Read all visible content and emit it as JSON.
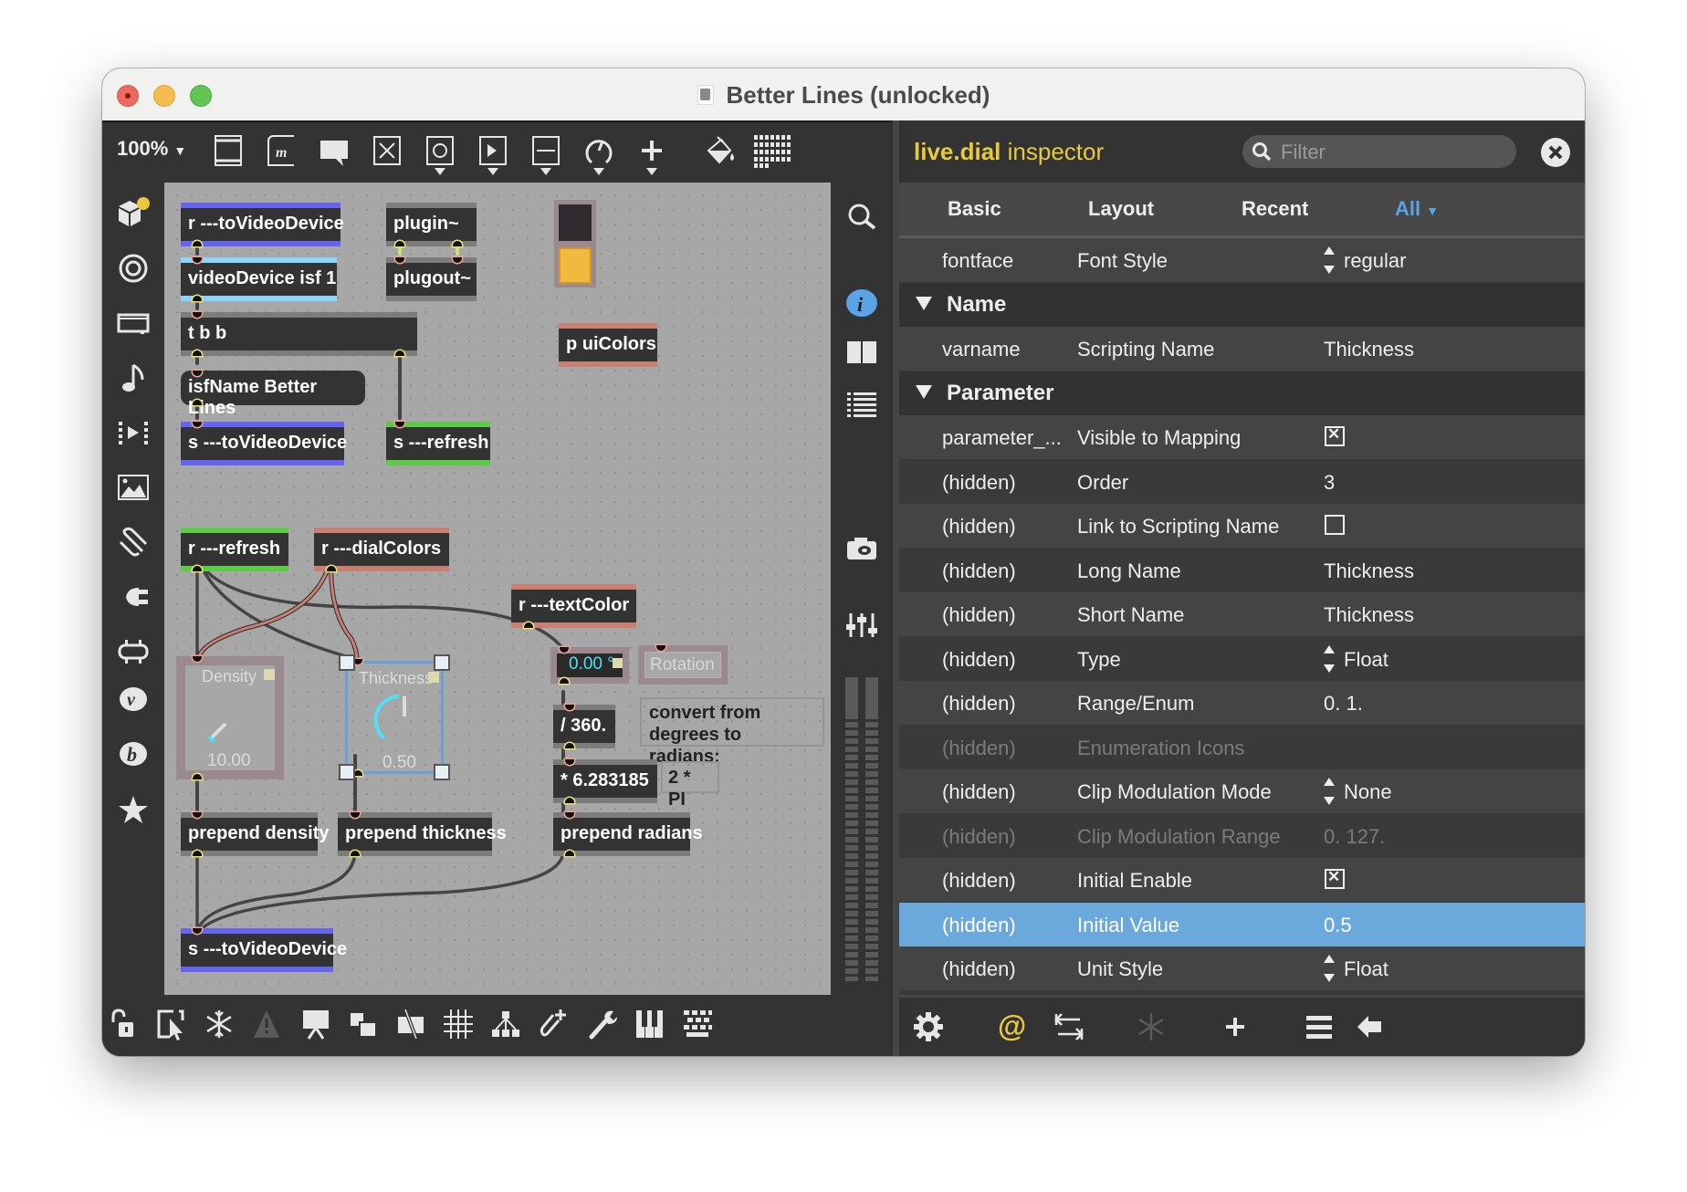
{
  "window": {
    "title": "Better Lines (unlocked)"
  },
  "toolbar": {
    "zoom": "100%",
    "icons": [
      "new-object-icon",
      "message-box-icon",
      "comment-icon",
      "toggle-icon",
      "button-icon",
      "playbar-icon",
      "slider-icon",
      "dial-icon",
      "add-icon",
      "paint-bucket-icon",
      "grid-palette-icon"
    ]
  },
  "sidebar": {
    "icons": [
      "packages-icon",
      "target-icon",
      "device-icon",
      "music-note-icon",
      "media-icon",
      "image-icon",
      "paperclip-icon",
      "plug-icon",
      "connector-icon",
      "v-icon",
      "b-icon",
      "star-icon"
    ]
  },
  "patcher": {
    "objects": {
      "r_toVideoDevice": "r ---toVideoDevice",
      "videoDevice": "videoDevice isf 1",
      "tbb": "t b b",
      "isfName": "isfName Better Lines",
      "s_toVideoDevice_top": "s ---toVideoDevice",
      "plugin": "plugin~",
      "plugout": "plugout~",
      "p_uiColors": "p uiColors",
      "s_refresh": "s ---refresh",
      "r_refresh": "r ---refresh",
      "r_dialColors": "r ---dialColors",
      "r_textColor": "r ---textColor",
      "div360": "/ 360.",
      "mul2pi": "* 6.283185",
      "prepend_density": "prepend density",
      "prepend_thickness": "prepend thickness",
      "prepend_radians": "prepend radians",
      "s_toVideoDevice_bottom": "s ---toVideoDevice"
    },
    "comments": {
      "convert": "convert from degrees to radians:",
      "two_pi": "2 * PI"
    },
    "dials": [
      {
        "label": "Density",
        "value": "10.00"
      },
      {
        "label": "Thickness",
        "value": "0.50",
        "fraction": 0.5
      }
    ],
    "numbox": {
      "value": "0.00 °"
    },
    "rotation_label": "Rotation"
  },
  "inspector": {
    "object_name": "live.dial",
    "title_suffix": "inspector",
    "filter_placeholder": "Filter",
    "tabs": [
      "Basic",
      "Layout",
      "Recent",
      "All"
    ],
    "active_tab": "All",
    "rows": [
      {
        "attr": "fontface",
        "label": "Font Style",
        "value": "regular",
        "kind": "stepper"
      },
      {
        "section": "Name"
      },
      {
        "attr": "varname",
        "label": "Scripting Name",
        "value": "Thickness",
        "kind": "text"
      },
      {
        "section": "Parameter"
      },
      {
        "attr": "parameter_...",
        "label": "Visible to Mapping",
        "value": true,
        "kind": "checkbox"
      },
      {
        "attr": "(hidden)",
        "label": "Order",
        "value": "3",
        "kind": "text"
      },
      {
        "attr": "(hidden)",
        "label": "Link to Scripting Name",
        "value": false,
        "kind": "checkbox"
      },
      {
        "attr": "(hidden)",
        "label": "Long Name",
        "value": "Thickness",
        "kind": "text"
      },
      {
        "attr": "(hidden)",
        "label": "Short Name",
        "value": "Thickness",
        "kind": "text"
      },
      {
        "attr": "(hidden)",
        "label": "Type",
        "value": "Float",
        "kind": "stepper"
      },
      {
        "attr": "(hidden)",
        "label": "Range/Enum",
        "value": "0. 1.",
        "kind": "text"
      },
      {
        "attr": "(hidden)",
        "label": "Enumeration Icons",
        "value": "",
        "kind": "text",
        "disabled": true
      },
      {
        "attr": "(hidden)",
        "label": "Clip Modulation Mode",
        "value": "None",
        "kind": "stepper"
      },
      {
        "attr": "(hidden)",
        "label": "Clip Modulation Range",
        "value": "0. 127.",
        "kind": "text",
        "disabled": true
      },
      {
        "attr": "(hidden)",
        "label": "Initial Enable",
        "value": true,
        "kind": "checkbox"
      },
      {
        "attr": "(hidden)",
        "label": "Initial Value",
        "value": "0.5",
        "kind": "text",
        "selected": true
      },
      {
        "attr": "(hidden)",
        "label": "Unit Style",
        "value": "Float",
        "kind": "stepper"
      }
    ],
    "footer_icons": [
      "gear-icon",
      "at-icon",
      "align-arrows-icon",
      "snowflake-icon",
      "add-icon",
      "menu-icon",
      "back-arrow-icon"
    ]
  },
  "bottombar": {
    "icons": [
      "unlock-icon",
      "select-cursor-icon",
      "freeze-icon",
      "warning-icon",
      "presentation-icon",
      "layers-icon",
      "hide-icon",
      "grid-icon",
      "hierarchy-icon",
      "add-attachment-icon",
      "wrench-icon",
      "piano-icon",
      "keyboard-icon"
    ]
  },
  "colors": {
    "accent_yellow": "#e9c93d",
    "selection_blue": "#6ba9dc",
    "send_receive_blue": "#6464f0",
    "video_light_blue": "#8cd4f8",
    "refresh_green": "#5ccc46",
    "color_salmon": "#c98072",
    "dial_cyan": "#4fe0f5"
  }
}
